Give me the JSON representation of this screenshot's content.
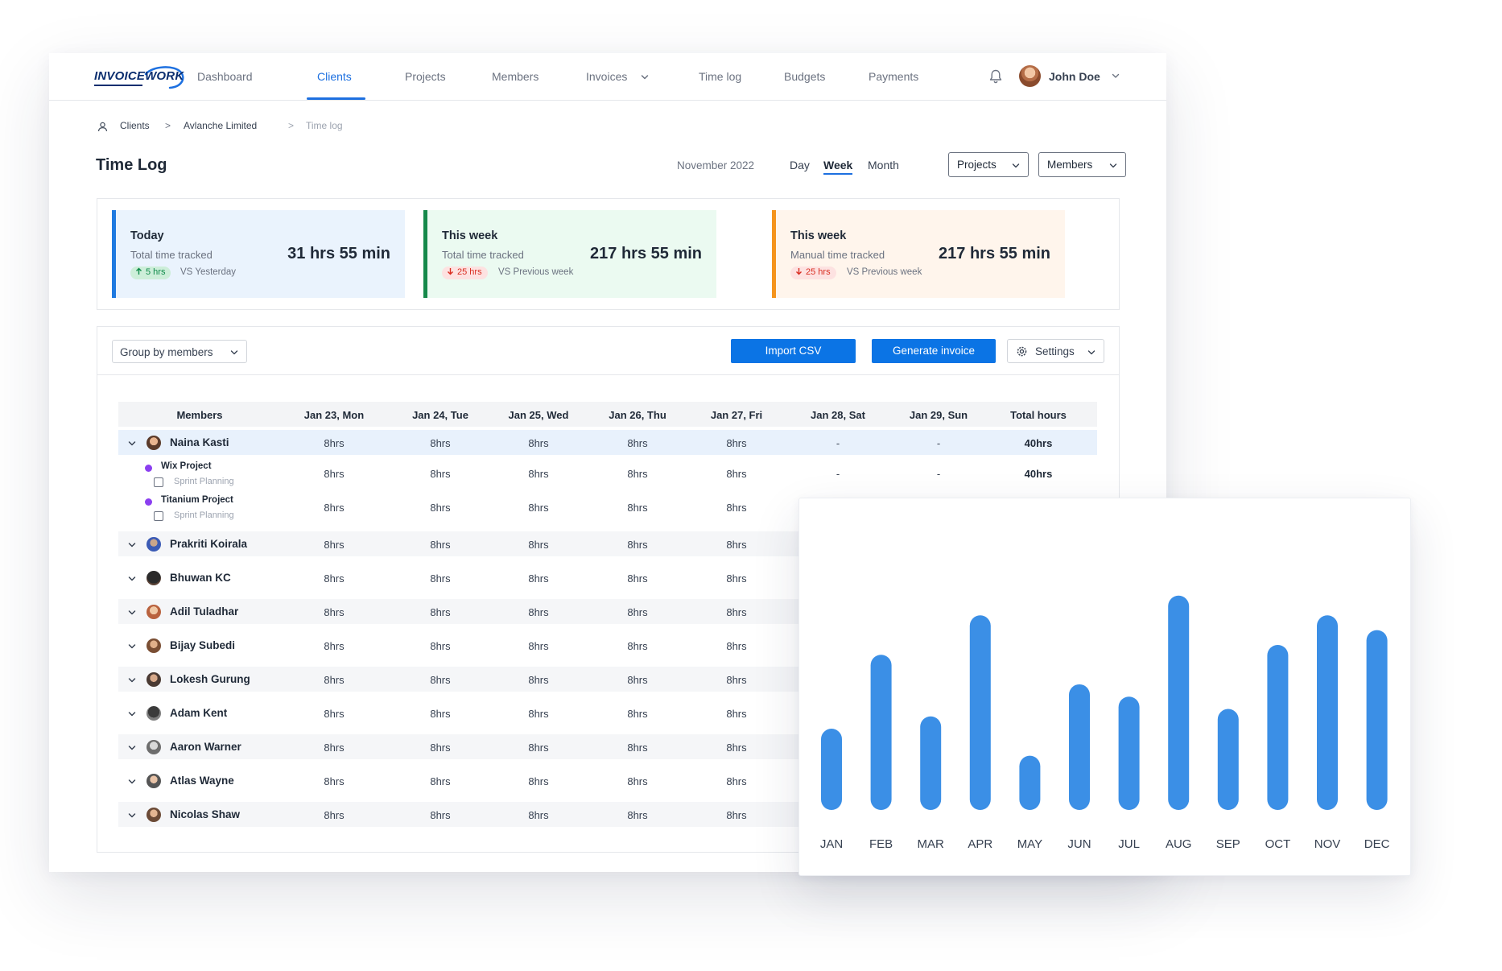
{
  "brand": {
    "logo_text": "INVOICEWORK",
    "color": "#0b2e6f",
    "accent": "#1d70e0"
  },
  "nav": {
    "items": [
      {
        "label": "Dashboard",
        "active": false
      },
      {
        "label": "Clients",
        "active": true
      },
      {
        "label": "Projects",
        "active": false
      },
      {
        "label": "Members",
        "active": false
      },
      {
        "label": "Invoices",
        "active": false,
        "has_dropdown": true
      },
      {
        "label": "Time log",
        "active": false
      },
      {
        "label": "Budgets",
        "active": false
      },
      {
        "label": "Payments",
        "active": false
      }
    ],
    "notification_icon": "bell-icon",
    "user": {
      "name": "John Doe"
    }
  },
  "breadcrumb": {
    "icon": "user-icon",
    "items": [
      "Clients",
      "Avlanche Limited",
      "Time log"
    ]
  },
  "page": {
    "title": "Time Log",
    "period": "November 2022",
    "range_tabs": [
      {
        "label": "Day",
        "active": false
      },
      {
        "label": "Week",
        "active": true
      },
      {
        "label": "Month",
        "active": false
      }
    ],
    "filters": [
      "Projects",
      "Members"
    ]
  },
  "stats": [
    {
      "title": "Today",
      "subtitle": "Total time tracked",
      "value": "31 hrs 55 min",
      "badge": "5 hrs",
      "trend": "up",
      "compare": "VS Yesterday",
      "accent": "#1f7ae0",
      "background": "#eaf3fd",
      "badge_color": "#0f8a4a",
      "badge_background": "#cdeed9"
    },
    {
      "title": "This week",
      "subtitle": "Total time tracked",
      "value": "217 hrs 55 min",
      "badge": "25 hrs",
      "trend": "down",
      "compare": "VS Previous week",
      "accent": "#15894a",
      "background": "#ebfaf1",
      "badge_color": "#d92d20",
      "badge_background": "#fde2e1"
    },
    {
      "title": "This week",
      "subtitle": "Manual time tracked",
      "value": "217 hrs 55 min",
      "badge": "25 hrs",
      "trend": "down",
      "compare": "VS Previous week",
      "accent": "#f5941d",
      "background": "#fff5ec",
      "badge_color": "#d92d20",
      "badge_background": "#fde2e1"
    }
  ],
  "toolbar": {
    "group_by": "Group by members",
    "import_label": "Import CSV",
    "generate_label": "Generate invoice",
    "settings_label": "Settings"
  },
  "table": {
    "columns": [
      "Members",
      "Jan 23, Mon",
      "Jan 24, Tue",
      "Jan 25, Wed",
      "Jan 26, Thu",
      "Jan 27, Fri",
      "Jan 28, Sat",
      "Jan 29, Sun",
      "Total hours"
    ],
    "rows": [
      {
        "name": "Naina Kasti",
        "values": [
          "8hrs",
          "8hrs",
          "8hrs",
          "8hrs",
          "8hrs",
          "-",
          "-",
          "40hrs"
        ],
        "expanded": true,
        "projects": [
          {
            "name": "Wix Project",
            "task": "Sprint Planning",
            "values": [
              "8hrs",
              "8hrs",
              "8hrs",
              "8hrs",
              "8hrs",
              "-",
              "-",
              "40hrs"
            ]
          },
          {
            "name": "Titanium Project",
            "task": "Sprint Planning",
            "values": [
              "8hrs",
              "8hrs",
              "8hrs",
              "8hrs",
              "8hrs"
            ]
          }
        ]
      },
      {
        "name": "Prakriti Koirala",
        "values": [
          "8hrs",
          "8hrs",
          "8hrs",
          "8hrs",
          "8hrs"
        ]
      },
      {
        "name": "Bhuwan KC",
        "values": [
          "8hrs",
          "8hrs",
          "8hrs",
          "8hrs",
          "8hrs"
        ]
      },
      {
        "name": "Adil Tuladhar",
        "values": [
          "8hrs",
          "8hrs",
          "8hrs",
          "8hrs",
          "8hrs"
        ]
      },
      {
        "name": "Bijay Subedi",
        "values": [
          "8hrs",
          "8hrs",
          "8hrs",
          "8hrs",
          "8hrs"
        ]
      },
      {
        "name": "Lokesh Gurung",
        "values": [
          "8hrs",
          "8hrs",
          "8hrs",
          "8hrs",
          "8hrs"
        ]
      },
      {
        "name": "Adam Kent",
        "values": [
          "8hrs",
          "8hrs",
          "8hrs",
          "8hrs",
          "8hrs"
        ]
      },
      {
        "name": "Aaron Warner",
        "values": [
          "8hrs",
          "8hrs",
          "8hrs",
          "8hrs",
          "8hrs"
        ]
      },
      {
        "name": "Atlas Wayne",
        "values": [
          "8hrs",
          "8hrs",
          "8hrs",
          "8hrs",
          "8hrs"
        ]
      },
      {
        "name": "Nicolas Shaw",
        "values": [
          "8hrs",
          "8hrs",
          "8hrs",
          "8hrs",
          "8hrs"
        ]
      }
    ]
  },
  "chart_data": {
    "type": "bar",
    "categories": [
      "JAN",
      "FEB",
      "MAR",
      "APR",
      "MAY",
      "JUN",
      "JUL",
      "AUG",
      "SEP",
      "OCT",
      "NOV",
      "DEC"
    ],
    "values": [
      33,
      63,
      38,
      79,
      22,
      51,
      46,
      87,
      41,
      67,
      79,
      73
    ],
    "ylim": [
      0,
      100
    ],
    "color": "#3b8fe6",
    "grid": false,
    "legend": "none",
    "title": "",
    "xlabel": "",
    "ylabel": ""
  }
}
